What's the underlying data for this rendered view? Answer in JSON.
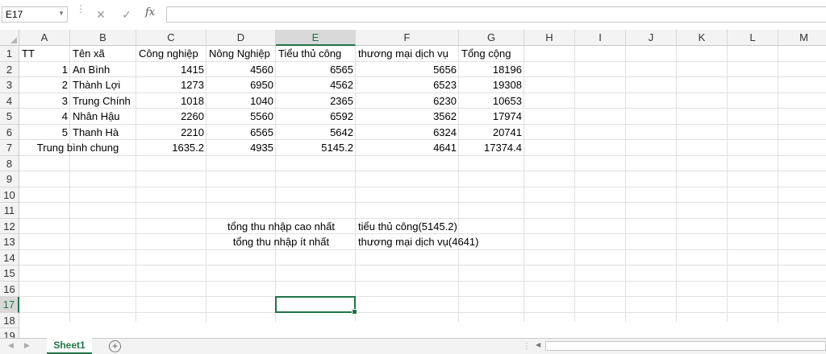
{
  "formula_bar": {
    "name_box": "E17",
    "cancel_icon": "✕",
    "enter_icon": "✓",
    "fx_label": "fx",
    "formula": ""
  },
  "columns": [
    "A",
    "B",
    "C",
    "D",
    "E",
    "F",
    "G",
    "H",
    "I",
    "J",
    "K",
    "L",
    "M"
  ],
  "selected_column": "E",
  "rows": [
    "1",
    "2",
    "3",
    "4",
    "5",
    "6",
    "7",
    "8",
    "9",
    "10",
    "11",
    "12",
    "13",
    "14",
    "15",
    "16",
    "17",
    "18",
    "19"
  ],
  "selected_row": "17",
  "table": {
    "headers": [
      "TT",
      "Tên xã",
      "Công nghiệp",
      "Nông Nghiệp",
      "Tiểu thủ công",
      "thương mại dịch vụ",
      "Tổng cộng"
    ],
    "rows": [
      [
        "1",
        "An Bình",
        "1415",
        "4560",
        "6565",
        "5656",
        "18196"
      ],
      [
        "2",
        "Thành Lợi",
        "1273",
        "6950",
        "4562",
        "6523",
        "19308"
      ],
      [
        "3",
        "Trung Chính",
        "1018",
        "1040",
        "2365",
        "6230",
        "10653"
      ],
      [
        "4",
        "Nhân Hậu",
        "2260",
        "5560",
        "6592",
        "3562",
        "17974"
      ],
      [
        "5",
        "Thanh Hà",
        "2210",
        "6565",
        "5642",
        "6324",
        "20741"
      ]
    ],
    "average": {
      "label": "Trung bình chung",
      "values": [
        "1635.2",
        "4935",
        "5145.2",
        "4641",
        "17374.4"
      ]
    }
  },
  "summary": {
    "highest_label": "tổng thu nhập cao nhất",
    "highest_value": "tiểu thủ công(5145.2)",
    "lowest_label": "tổng thu nhập ít nhất",
    "lowest_value": "thương mại dịch vụ(4641)"
  },
  "sheet_tabs": {
    "active": "Sheet1",
    "add_icon": "+"
  },
  "colors": {
    "accent": "#217346"
  }
}
